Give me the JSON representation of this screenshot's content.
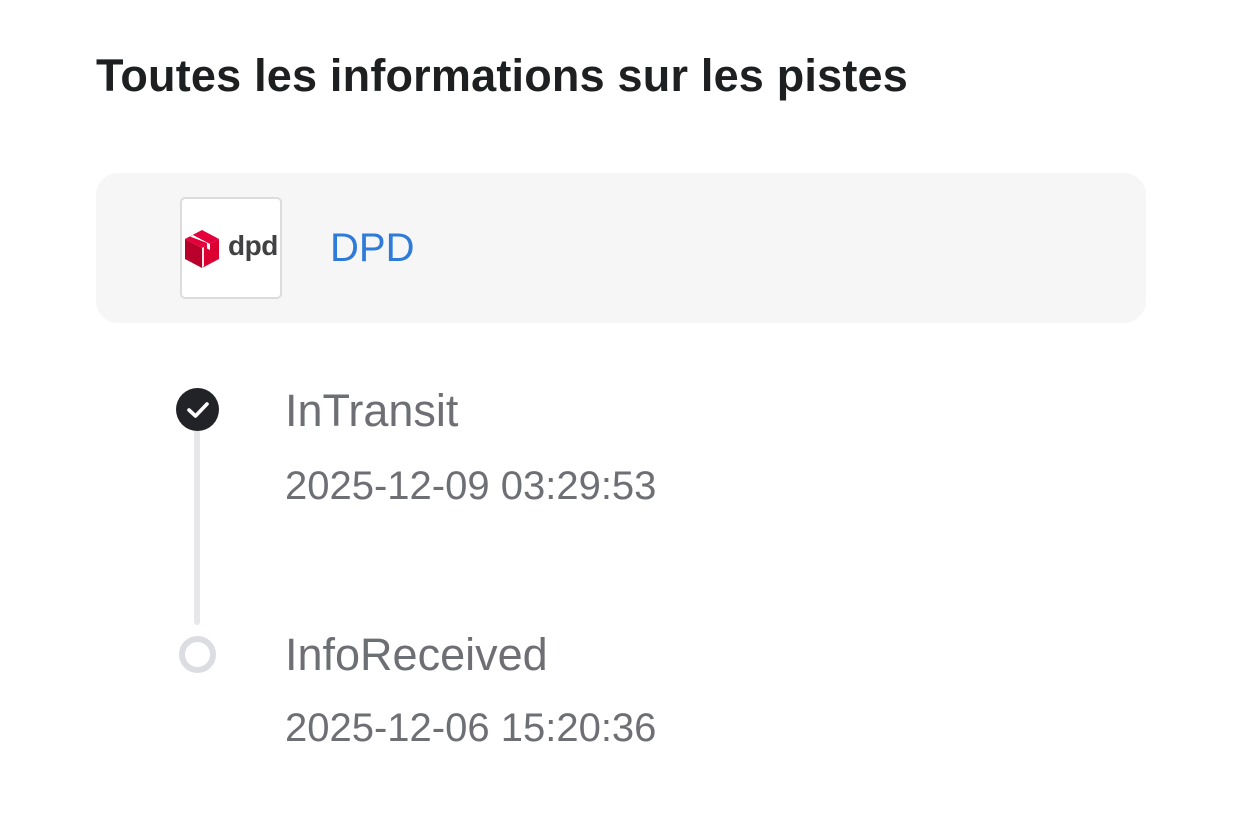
{
  "page": {
    "title": "Toutes les informations sur les pistes"
  },
  "carrier": {
    "logo_text": "dpd",
    "name": "DPD",
    "logo_icon": "dpd-cube-icon",
    "brand_color": "#dc0032",
    "link_color": "#2f7bd9"
  },
  "events": [
    {
      "status": "InTransit",
      "time": "2025-12-09 03:29:53",
      "state": "done",
      "icon": "check-icon"
    },
    {
      "status": "InfoReceived",
      "time": "2025-12-06 15:20:36",
      "state": "pending",
      "icon": "circle-outline-icon"
    }
  ]
}
